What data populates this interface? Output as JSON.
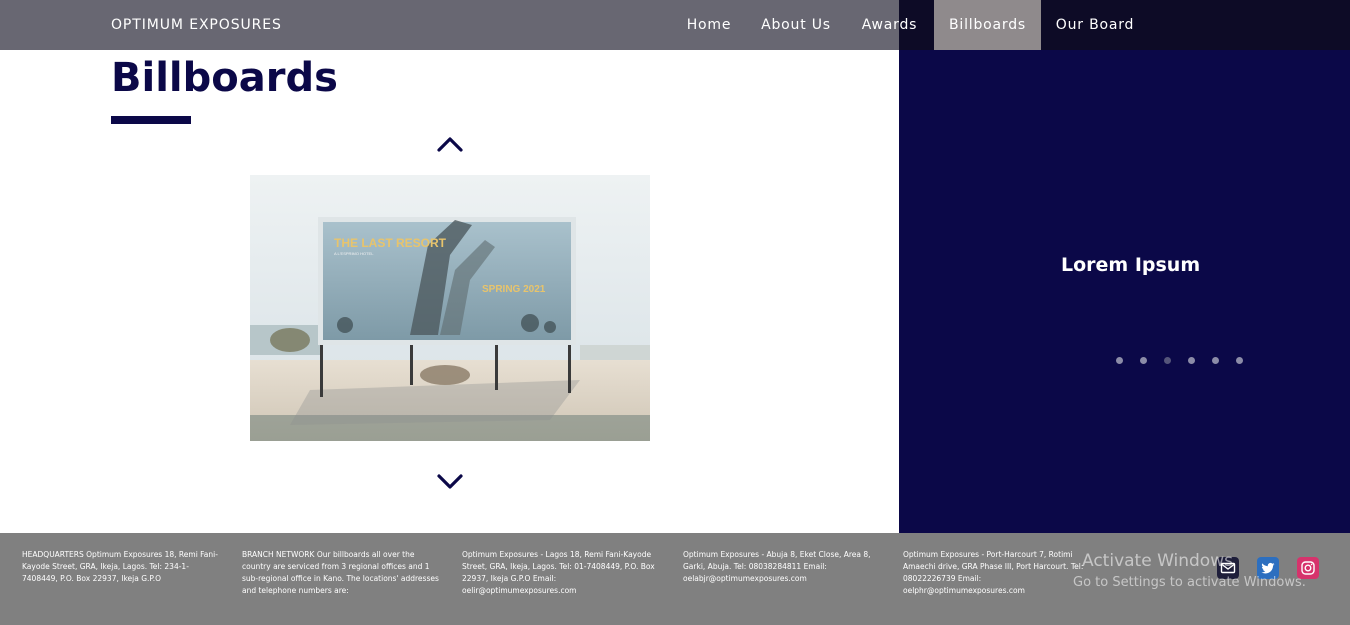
{
  "brand": "OPTIMUM EXPOSURES",
  "nav": {
    "items": [
      {
        "label": "Home"
      },
      {
        "label": "About Us"
      },
      {
        "label": "Awards"
      },
      {
        "label": "Billboards"
      },
      {
        "label": "Our Board"
      }
    ],
    "active": "Billboards"
  },
  "page": {
    "title": "Billboards"
  },
  "billboard_image": {
    "headline": "THE LAST RESORT",
    "subline": "A L'ESPRIMO HOTEL",
    "tagline": "SPRING 2021"
  },
  "carousel": {
    "title": "Lorem Ipsum",
    "dot_count": 6,
    "active_dot": 3
  },
  "footer": {
    "columns": [
      {
        "text": "HEADQUARTERS Optimum Exposures 18, Remi Fani-Kayode Street, GRA, Ikeja, Lagos. Tel: 234-1-7408449, P.O. Box 22937, Ikeja G.P.O"
      },
      {
        "text": "BRANCH NETWORK Our billboards all over the country are serviced from 3 regional offices and 1 sub-regional office in Kano. The locations' addresses and telephone numbers are:"
      },
      {
        "text": "Optimum Exposures - Lagos 18, Remi Fani-Kayode Street, GRA, Ikeja, Lagos. Tel: 01-7408449, P.O. Box 22937, Ikeja G.P.O Email: oelir@optimumexposures.com"
      },
      {
        "text": "Optimum Exposures - Abuja 8, Eket Close, Area 8, Garki, Abuja. Tel: 08038284811 Email: oelabjr@optimumexposures.com"
      },
      {
        "text": "Optimum Exposures - Port-Harcourt 7, Rotimi Amaechi drive, GRA Phase III, Port Harcourt. Tel: 08022226739 Email: oelphr@optimumexposures.com"
      }
    ],
    "social": [
      "mail-icon",
      "twitter-icon",
      "instagram-icon"
    ]
  },
  "watermark": {
    "line1": "Activate Windows",
    "line2": "Go to Settings to activate Windows."
  },
  "colors": {
    "navy": "#0b0848",
    "footer_gray": "#808080",
    "nav_active": "#8f8a8c"
  }
}
